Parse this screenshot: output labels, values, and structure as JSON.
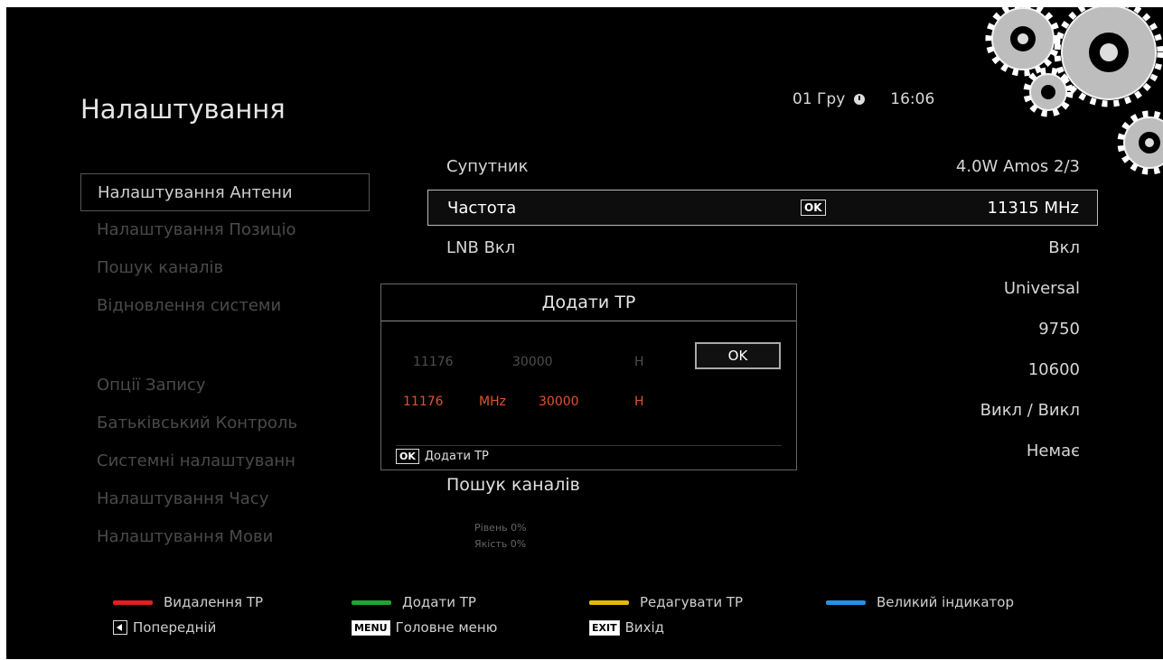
{
  "header": {
    "title": "Налаштування",
    "date": "01 Гру",
    "time": "16:06"
  },
  "menu": {
    "items": [
      {
        "label": "Налаштування Антени"
      },
      {
        "label": "Налаштування Позиціо"
      },
      {
        "label": "Пошук каналів"
      },
      {
        "label": "Відновлення системи"
      },
      {
        "label": "Опції Запису"
      },
      {
        "label": "Батьківський Контроль"
      },
      {
        "label": "Системні налаштуванн"
      },
      {
        "label": "Налаштування Часу"
      },
      {
        "label": "Налаштування Мови"
      }
    ]
  },
  "settings": {
    "rows": [
      {
        "label": "Супутник",
        "value": "4.0W Amos 2/3"
      },
      {
        "label": "Частота",
        "value": "11315 MHz",
        "badge": "OK"
      },
      {
        "label": "LNB Вкл",
        "value": "Вкл"
      },
      {
        "label": "",
        "value": "Universal"
      },
      {
        "label": "",
        "value": "9750"
      },
      {
        "label": "",
        "value": "10600"
      },
      {
        "label": "",
        "value": "Викл / Викл"
      },
      {
        "label": "",
        "value": "Немає"
      }
    ],
    "search_label": "Пошук каналів",
    "level": "Рівень  0%",
    "quality": "Якість  0%"
  },
  "dialog": {
    "title": "Додати TP",
    "prev": {
      "freq": "11176",
      "symbol": "30000",
      "pol": "H"
    },
    "edit": {
      "freq": "11176",
      "unit": "MHz",
      "symbol": "30000",
      "pol": "H"
    },
    "ok_label": "OK",
    "hint_key": "OK",
    "hint_label": "Додати TP"
  },
  "legend": {
    "red": "Видалення TP",
    "green": "Додати TP",
    "yellow": "Редагувати TP",
    "blue": "Великий індикатор",
    "prev": "Попередній",
    "menu_key": "MENU",
    "menu": "Головне меню",
    "exit_key": "EXIT",
    "exit": "Вихід"
  },
  "colors": {
    "red": "#e0201c",
    "green": "#22a52c",
    "yellow": "#e6b800",
    "blue": "#2a8fe0",
    "accent": "#e0522f"
  }
}
